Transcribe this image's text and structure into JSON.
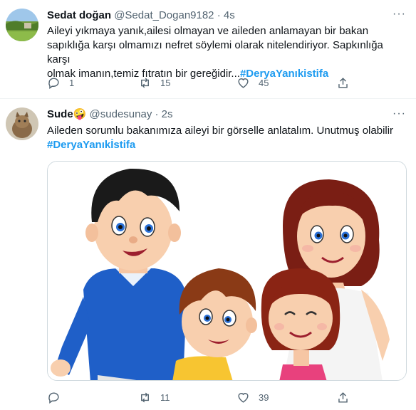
{
  "tweets": [
    {
      "author_name": "Sedat doğan",
      "handle": "@Sedat_Dogan9182",
      "separator": "·",
      "time": "4s",
      "text_line1": "Aileyi yıkmaya yanık,ailesi olmayan ve aileden anlamayan bir bakan",
      "text_line2": "sapıklığa karşı olmamızı nefret söylemi olarak nitelendiriyor. Sapkınlığa karşı",
      "text_line3": "olmak imanın,temiz fıtratın bir gereğidir...",
      "hashtag": "#DeryaYanıkistifa",
      "more": "···",
      "reply_count": "1",
      "retweet_count": "15",
      "like_count": "45"
    },
    {
      "author_name": "Sude",
      "emoji": "🤪",
      "handle": "@sudesunay",
      "separator": "·",
      "time": "2s",
      "text_line1": "Aileden sorumlu bakanımıza aileyi bir görselle anlatalım. Unutmuş olabilir",
      "hashtag": "#DeryaYanıkİstifa",
      "more": "···",
      "reply_count": "",
      "retweet_count": "11",
      "like_count": "39"
    }
  ],
  "icons": {
    "reply": "reply-icon",
    "retweet": "retweet-icon",
    "like": "heart-icon",
    "share": "share-icon",
    "more": "more-icon"
  },
  "colors": {
    "hashtag": "#1d9bf0",
    "text": "#0f1419",
    "secondary": "#536471",
    "border": "#eff3f4"
  }
}
